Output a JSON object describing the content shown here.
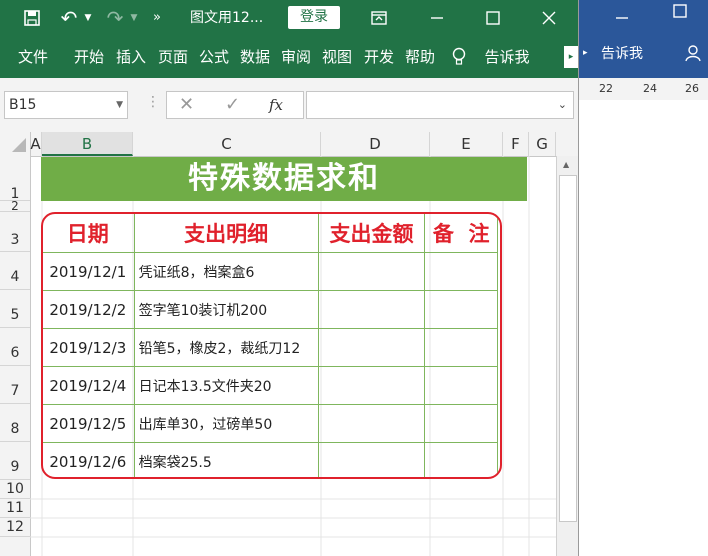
{
  "excel": {
    "title": "图文用12...",
    "login_label": "登录",
    "tabs": [
      "文件",
      "开始",
      "插入",
      "页面",
      "公式",
      "数据",
      "审阅",
      "视图",
      "开发",
      "帮助"
    ],
    "tell_me": "告诉我",
    "name_box": "B15",
    "fx_label": "fx",
    "columns": [
      "A",
      "B",
      "C",
      "D",
      "E",
      "F",
      "G"
    ],
    "rows": [
      "1",
      "2",
      "3",
      "4",
      "5",
      "6",
      "7",
      "8",
      "9",
      "10",
      "11",
      "12"
    ],
    "sheet": {
      "banner": "特殊数据求和",
      "headers": [
        "日期",
        "支出明细",
        "支出金额",
        "备  注"
      ],
      "data": [
        {
          "date": "2019/12/1",
          "detail": "凭证纸8，档案盒6"
        },
        {
          "date": "2019/12/2",
          "detail": "签字笔10装订机200"
        },
        {
          "date": "2019/12/3",
          "detail": "铅笔5，橡皮2，裁纸刀12"
        },
        {
          "date": "2019/12/4",
          "detail": "日记本13.5文件夹20"
        },
        {
          "date": "2019/12/5",
          "detail": "出库单30，过磅单50"
        },
        {
          "date": "2019/12/6",
          "detail": "档案袋25.5"
        }
      ]
    }
  },
  "word": {
    "tell_me": "告诉我",
    "ruler": [
      "22",
      "24",
      "26"
    ]
  },
  "colors": {
    "excel_green": "#217346",
    "banner_green": "#70ad47",
    "red": "#e0212c",
    "word_blue": "#2b579a"
  }
}
